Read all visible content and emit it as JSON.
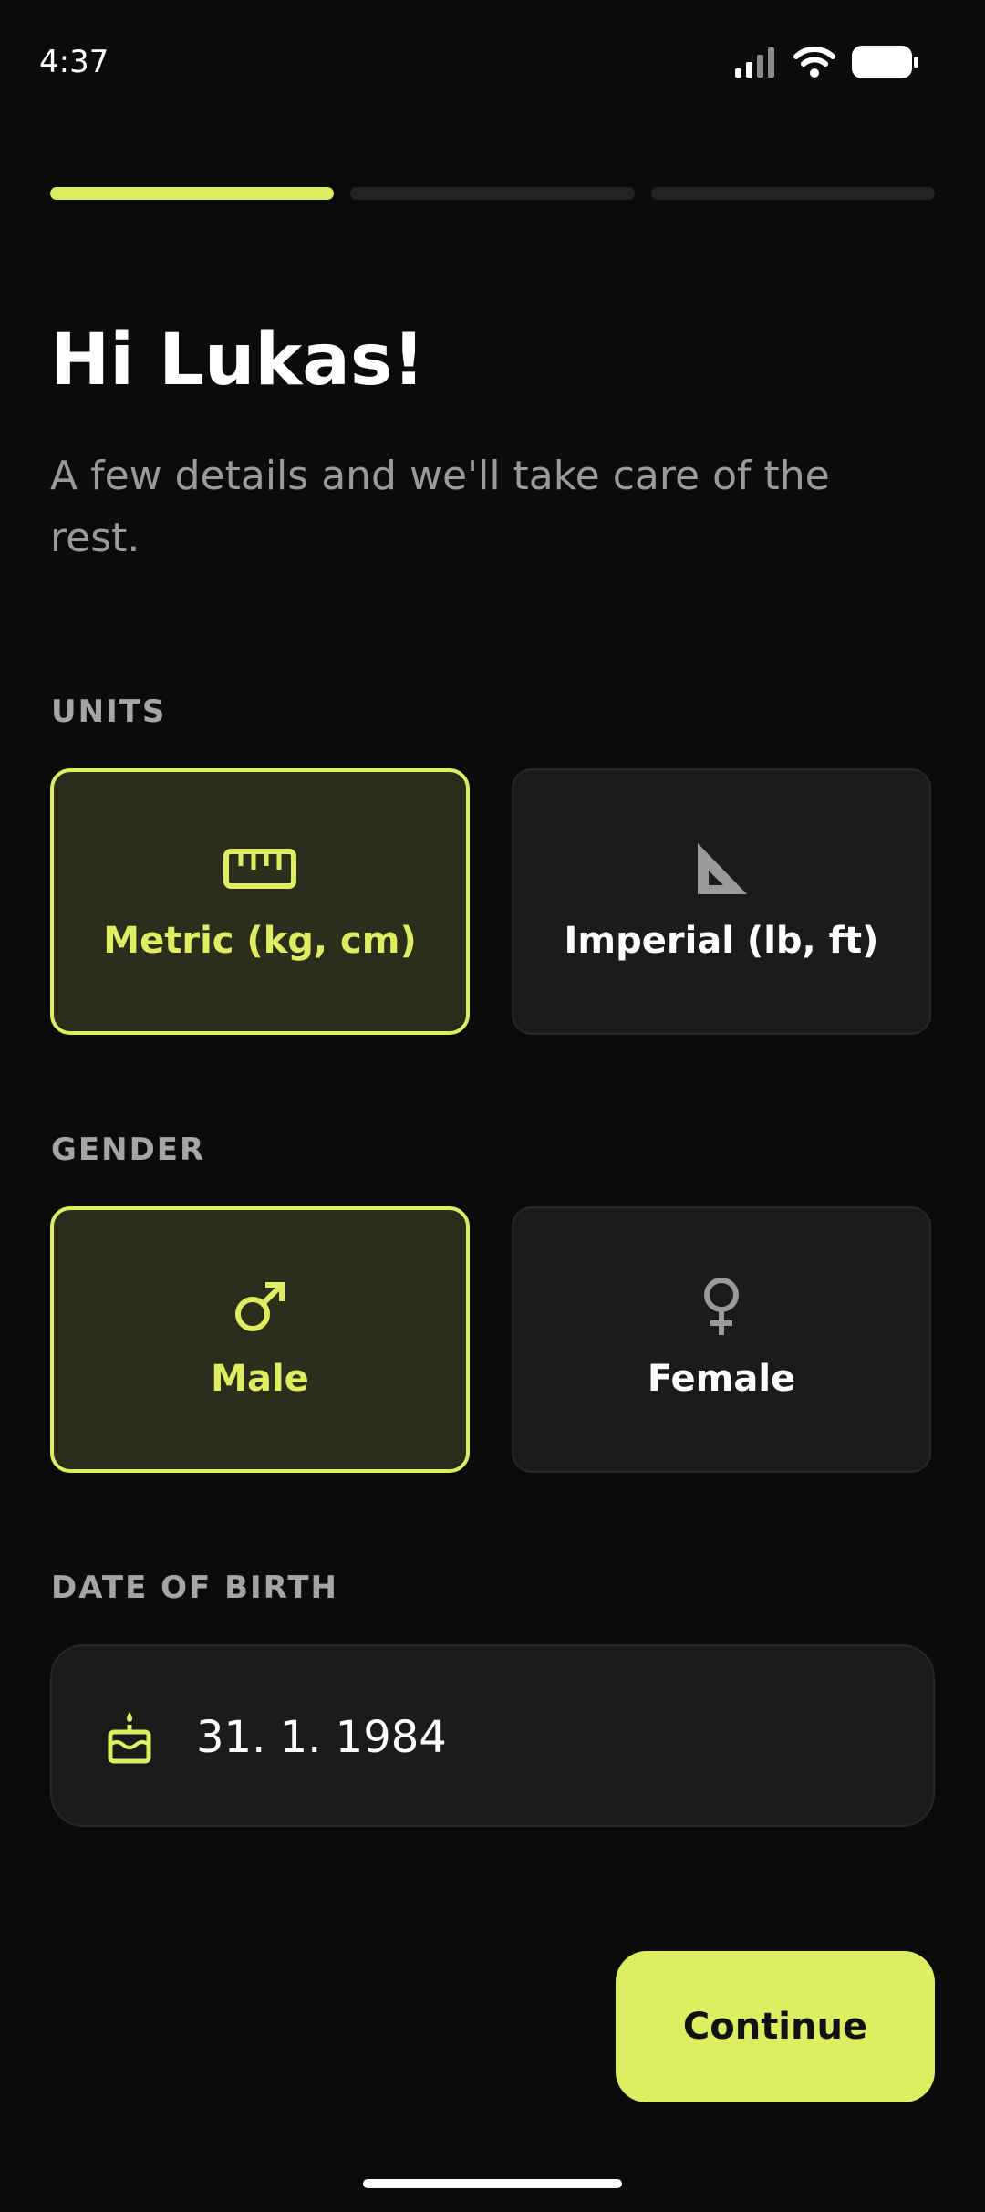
{
  "status_bar": {
    "time": "4:37",
    "icons": [
      "signal-icon",
      "wifi-icon",
      "battery-icon"
    ]
  },
  "progress": {
    "total_steps": 3,
    "current_step": 1
  },
  "header": {
    "title": "Hi Lukas!",
    "subtitle": "A few details and we'll take care of the rest."
  },
  "units": {
    "label": "UNITS",
    "options": [
      {
        "label": "Metric (kg, cm)",
        "icon": "ruler-icon",
        "selected": true
      },
      {
        "label": "Imperial (lb, ft)",
        "icon": "set-square-icon",
        "selected": false
      }
    ]
  },
  "gender": {
    "label": "GENDER",
    "options": [
      {
        "label": "Male",
        "icon": "male-symbol-icon",
        "selected": true
      },
      {
        "label": "Female",
        "icon": "female-symbol-icon",
        "selected": false
      }
    ]
  },
  "date_of_birth": {
    "label": "DATE OF BIRTH",
    "icon": "birthday-cake-icon",
    "value": "31. 1. 1984"
  },
  "actions": {
    "continue_label": "Continue"
  },
  "colors": {
    "background": "#0b0b0b",
    "accent": "#dcef63",
    "card": "#1b1b1b",
    "selected_card": "#2c2e1b",
    "muted_text": "#9a9a9a"
  }
}
